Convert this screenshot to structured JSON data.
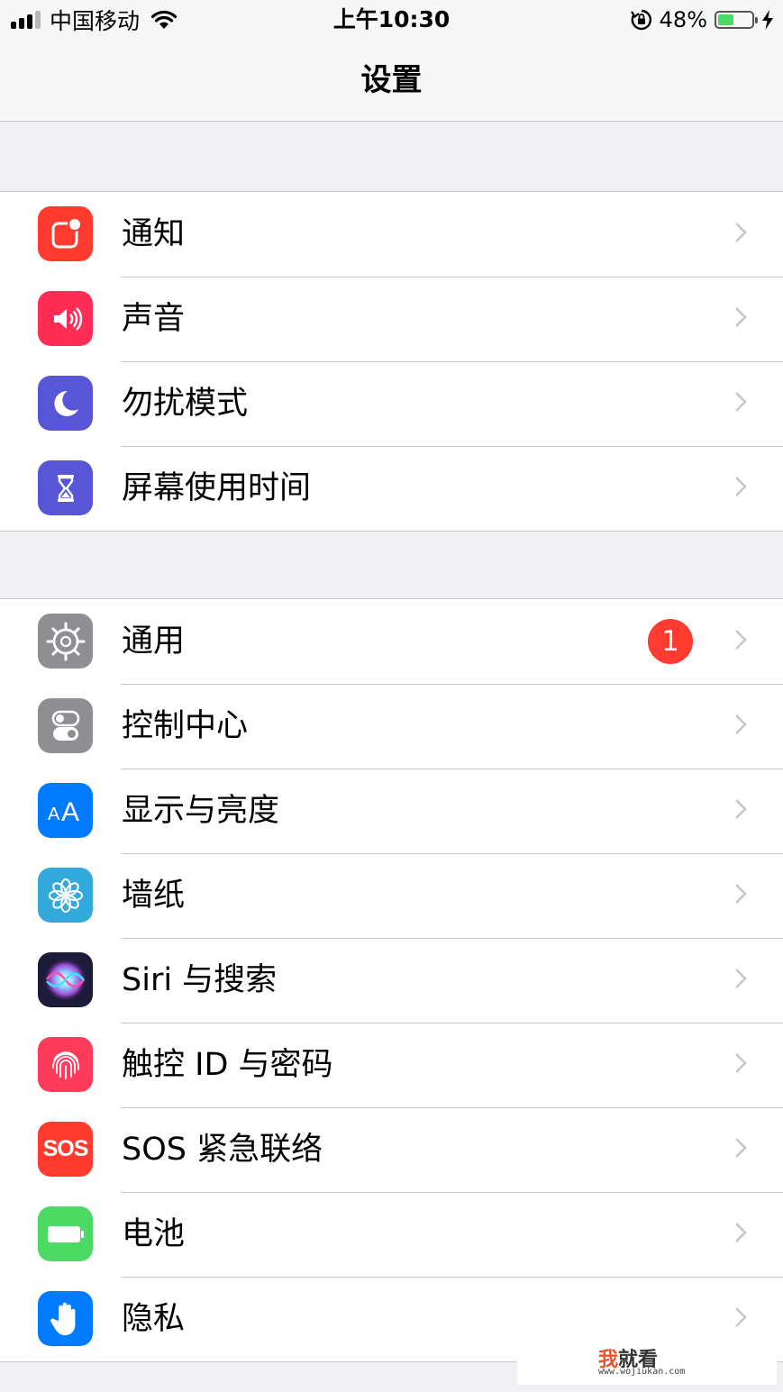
{
  "status_bar": {
    "carrier": "中国移动",
    "time": "上午10:30",
    "battery_percent": "48%",
    "battery_level": 0.48,
    "signal_bars_filled": 3,
    "signal_bars_total": 4
  },
  "nav": {
    "title": "设置"
  },
  "groups": [
    {
      "items": [
        {
          "label": "通知",
          "icon": "notifications-icon",
          "color": "#ff3b30"
        },
        {
          "label": "声音",
          "icon": "sound-icon",
          "color": "#ff2d55"
        },
        {
          "label": "勿扰模式",
          "icon": "moon-icon",
          "color": "#5856d6"
        },
        {
          "label": "屏幕使用时间",
          "icon": "hourglass-icon",
          "color": "#5856d6"
        }
      ]
    },
    {
      "items": [
        {
          "label": "通用",
          "icon": "gear-icon",
          "color": "#8e8e93",
          "badge": "1"
        },
        {
          "label": "控制中心",
          "icon": "toggles-icon",
          "color": "#8e8e93"
        },
        {
          "label": "显示与亮度",
          "icon": "text-size-icon",
          "color": "#007aff"
        },
        {
          "label": "墙纸",
          "icon": "flower-icon",
          "color": "#34aadc"
        },
        {
          "label": "Siri 与搜索",
          "icon": "siri-icon",
          "color": "#1c1c3a"
        },
        {
          "label": "触控 ID 与密码",
          "icon": "fingerprint-icon",
          "color": "#ff3b5c"
        },
        {
          "label": "SOS 紧急联络",
          "icon": "sos-icon",
          "color": "#ff3b30",
          "icon_text": "SOS"
        },
        {
          "label": "电池",
          "icon": "battery-icon",
          "color": "#4cd964"
        },
        {
          "label": "隐私",
          "icon": "hand-icon",
          "color": "#007aff"
        }
      ]
    }
  ],
  "watermark": {
    "brand_first": "我",
    "brand_rest": "就看",
    "url": "www.wojiukan.com"
  }
}
